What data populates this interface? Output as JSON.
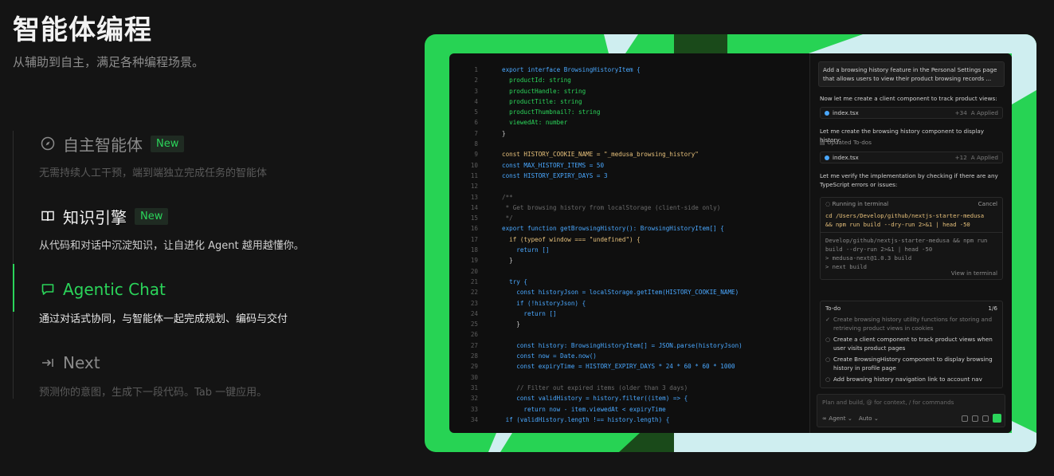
{
  "header": {
    "title": "智能体编程",
    "subtitle": "从辅助到自主，满足各种编程场景。"
  },
  "features": [
    {
      "title": "自主智能体",
      "badge": "New",
      "desc": "无需持续人工干预，端到端独立完成任务的智能体",
      "icon": "compass-icon"
    },
    {
      "title": "知识引擎",
      "badge": "New",
      "desc": "从代码和对话中沉淀知识，让自进化 Agent 越用越懂你。",
      "icon": "book-icon"
    },
    {
      "title": "Agentic Chat",
      "badge": "",
      "desc": "通过对话式协同，与智能体一起完成规划、编码与交付",
      "icon": "chat-icon"
    },
    {
      "title": "Next",
      "badge": "",
      "desc": "预测你的意图，生成下一段代码。Tab 一键应用。",
      "icon": "tab-arrow-icon"
    }
  ],
  "editor": {
    "lines": [
      {
        "n": "1",
        "c": "export interface BrowsingHistoryItem {"
      },
      {
        "n": "2",
        "c": "  productId: string"
      },
      {
        "n": "3",
        "c": "  productHandle: string"
      },
      {
        "n": "4",
        "c": "  productTitle: string"
      },
      {
        "n": "5",
        "c": "  productThumbnail?: string"
      },
      {
        "n": "6",
        "c": "  viewedAt: number"
      },
      {
        "n": "7",
        "c": "}"
      },
      {
        "n": "8",
        "c": ""
      },
      {
        "n": "9",
        "c": "const HISTORY_COOKIE_NAME = \"_medusa_browsing_history\""
      },
      {
        "n": "10",
        "c": "const MAX_HISTORY_ITEMS = 50"
      },
      {
        "n": "11",
        "c": "const HISTORY_EXPIRY_DAYS = 3"
      },
      {
        "n": "12",
        "c": ""
      },
      {
        "n": "13",
        "c": "/**"
      },
      {
        "n": "14",
        "c": " * Get browsing history from localStorage (client-side only)"
      },
      {
        "n": "15",
        "c": " */"
      },
      {
        "n": "16",
        "c": "export function getBrowsingHistory(): BrowsingHistoryItem[] {"
      },
      {
        "n": "17",
        "c": "  if (typeof window === \"undefined\") {"
      },
      {
        "n": "18",
        "c": "    return []"
      },
      {
        "n": "19",
        "c": "  }"
      },
      {
        "n": "20",
        "c": ""
      },
      {
        "n": "21",
        "c": "  try {"
      },
      {
        "n": "22",
        "c": "    const historyJson = localStorage.getItem(HISTORY_COOKIE_NAME)"
      },
      {
        "n": "23",
        "c": "    if (!historyJson) {"
      },
      {
        "n": "24",
        "c": "      return []"
      },
      {
        "n": "25",
        "c": "    }"
      },
      {
        "n": "26",
        "c": ""
      },
      {
        "n": "27",
        "c": "    const history: BrowsingHistoryItem[] = JSON.parse(historyJson)"
      },
      {
        "n": "28",
        "c": "    const now = Date.now()"
      },
      {
        "n": "29",
        "c": "    const expiryTime = HISTORY_EXPIRY_DAYS * 24 * 60 * 60 * 1000"
      },
      {
        "n": "30",
        "c": ""
      },
      {
        "n": "31",
        "c": "    // Filter out expired items (older than 3 days)"
      },
      {
        "n": "32",
        "c": "    const validHistory = history.filter((item) => {"
      },
      {
        "n": "33",
        "c": "      return now - item.viewedAt < expiryTime"
      },
      {
        "n": "34",
        "c": " if (validHistory.length !== history.length) {"
      }
    ]
  },
  "chat": {
    "prompt": "Add a browsing history feature in the Personal Settings page that allows users to view their product browsing records ...",
    "msg1": "Now let me create a client component to track product views:",
    "file1": {
      "name": "index.tsx",
      "diff": "+34",
      "status": "Applied"
    },
    "msg2": "Let me create the browsing history component to display history:",
    "todos_updated": "Updated To-dos",
    "file2": {
      "name": "index.tsx",
      "diff": "+12",
      "status": "Applied"
    },
    "msg3": "Let me verify the implementation by checking if there are any TypeScript errors or issues:",
    "terminal": {
      "status": "Running in terminal",
      "cancel": "Cancel",
      "cmd1": "cd /Users/Develop/github/nextjs-starter-medusa",
      "cmd2": "&& npm run build --dry-run 2>&1 | head -50",
      "out1": "Develop/github/nextjs-starter-medusa && npm run",
      "out2": "build --dry-run 2>&1 | head -50",
      "out3": "> medusa-next@1.0.3 build",
      "out4": "> next build",
      "view": "View in terminal"
    },
    "todo": {
      "title": "To-do",
      "count": "1/6",
      "items": [
        "Create browsing history utility functions for storing and retrieving product views in cookies",
        "Create a client component to track product views when user visits product pages",
        "Create BrowsingHistory component to display browsing history in profile page",
        "Add browsing history navigation link to account nav"
      ]
    },
    "composer": {
      "placeholder": "Plan and build, @ for context, / for commands",
      "agent": "Agent",
      "model": "Auto"
    }
  },
  "colors": {
    "accent": "#2bd45a",
    "background": "#141414",
    "showcase": "#27d354"
  }
}
